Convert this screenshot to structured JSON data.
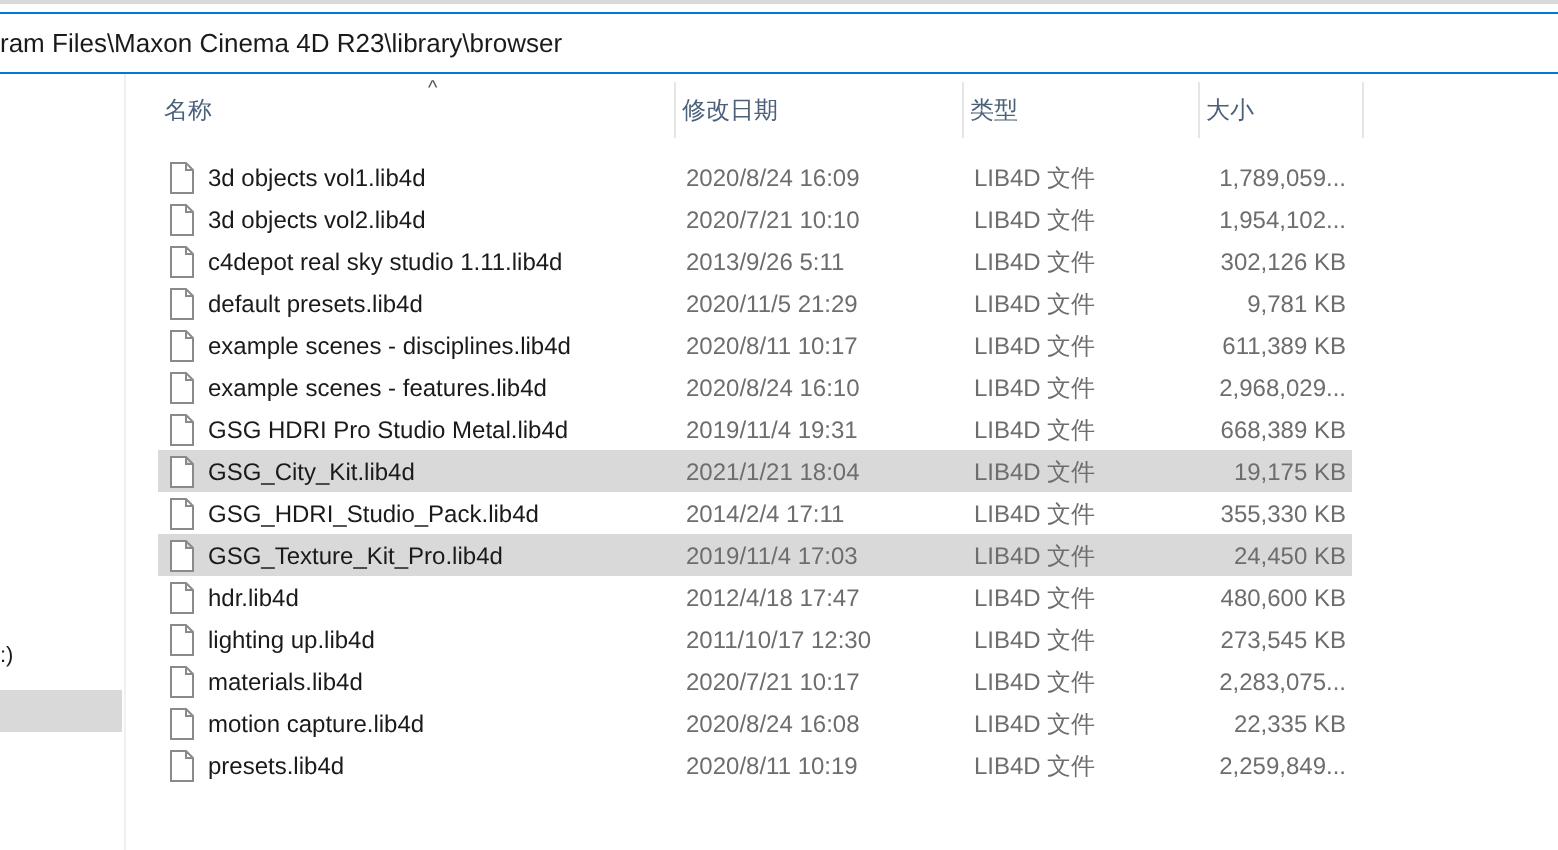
{
  "address_bar": {
    "path": "ram Files\\Maxon Cinema 4D R23\\library\\browser"
  },
  "sidebar": {
    "items": [
      {
        "label": ":)",
        "selected": false
      },
      {
        "selected": true
      }
    ]
  },
  "table": {
    "sort_indicator": "^",
    "columns": [
      "名称",
      "修改日期",
      "类型",
      "大小"
    ],
    "rows": [
      {
        "name": "3d objects vol1.lib4d",
        "modified": "2020/8/24 16:09",
        "type": "LIB4D 文件",
        "size": "1,789,059...",
        "selected": false
      },
      {
        "name": "3d objects vol2.lib4d",
        "modified": "2020/7/21 10:10",
        "type": "LIB4D 文件",
        "size": "1,954,102...",
        "selected": false
      },
      {
        "name": "c4depot real sky studio 1.11.lib4d",
        "modified": "2013/9/26 5:11",
        "type": "LIB4D 文件",
        "size": "302,126 KB",
        "selected": false
      },
      {
        "name": "default presets.lib4d",
        "modified": "2020/11/5 21:29",
        "type": "LIB4D 文件",
        "size": "9,781 KB",
        "selected": false
      },
      {
        "name": "example scenes - disciplines.lib4d",
        "modified": "2020/8/11 10:17",
        "type": "LIB4D 文件",
        "size": "611,389 KB",
        "selected": false
      },
      {
        "name": "example scenes - features.lib4d",
        "modified": "2020/8/24 16:10",
        "type": "LIB4D 文件",
        "size": "2,968,029...",
        "selected": false
      },
      {
        "name": "GSG HDRI Pro Studio Metal.lib4d",
        "modified": "2019/11/4 19:31",
        "type": "LIB4D 文件",
        "size": "668,389 KB",
        "selected": false
      },
      {
        "name": "GSG_City_Kit.lib4d",
        "modified": "2021/1/21 18:04",
        "type": "LIB4D 文件",
        "size": "19,175 KB",
        "selected": true
      },
      {
        "name": "GSG_HDRI_Studio_Pack.lib4d",
        "modified": "2014/2/4 17:11",
        "type": "LIB4D 文件",
        "size": "355,330 KB",
        "selected": false
      },
      {
        "name": "GSG_Texture_Kit_Pro.lib4d",
        "modified": "2019/11/4 17:03",
        "type": "LIB4D 文件",
        "size": "24,450 KB",
        "selected": true
      },
      {
        "name": "hdr.lib4d",
        "modified": "2012/4/18 17:47",
        "type": "LIB4D 文件",
        "size": "480,600 KB",
        "selected": false
      },
      {
        "name": "lighting up.lib4d",
        "modified": "2011/10/17 12:30",
        "type": "LIB4D 文件",
        "size": "273,545 KB",
        "selected": false
      },
      {
        "name": "materials.lib4d",
        "modified": "2020/7/21 10:17",
        "type": "LIB4D 文件",
        "size": "2,283,075...",
        "selected": false
      },
      {
        "name": "motion capture.lib4d",
        "modified": "2020/8/24 16:08",
        "type": "LIB4D 文件",
        "size": "22,335 KB",
        "selected": false
      },
      {
        "name": "presets.lib4d",
        "modified": "2020/8/11 10:19",
        "type": "LIB4D 文件",
        "size": "2,259,849...",
        "selected": false
      }
    ]
  }
}
